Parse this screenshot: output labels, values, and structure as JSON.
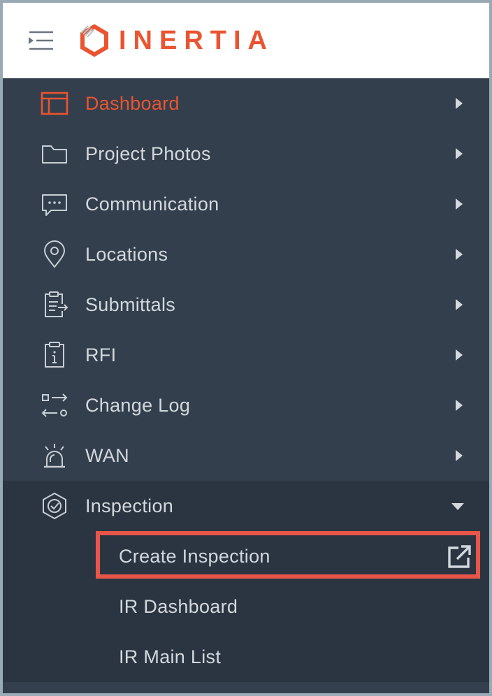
{
  "brand": {
    "name": "INERTIA",
    "color": "#ea5430"
  },
  "header": {
    "menu_icon": "menu-collapse-icon"
  },
  "nav": {
    "items": [
      {
        "label": "Dashboard",
        "icon": "dashboard-icon",
        "active": true
      },
      {
        "label": "Project Photos",
        "icon": "folder-icon"
      },
      {
        "label": "Communication",
        "icon": "chat-icon"
      },
      {
        "label": "Locations",
        "icon": "location-pin-icon"
      },
      {
        "label": "Submittals",
        "icon": "clipboard-arrow-icon"
      },
      {
        "label": "RFI",
        "icon": "clipboard-info-icon"
      },
      {
        "label": "Change Log",
        "icon": "swap-arrows-icon"
      },
      {
        "label": "WAN",
        "icon": "alarm-light-icon"
      }
    ],
    "inspection": {
      "label": "Inspection",
      "icon": "shield-check-icon",
      "expanded": true,
      "children": [
        {
          "label": "Create Inspection",
          "icon": "external-link-icon",
          "highlighted": true
        },
        {
          "label": "IR Dashboard"
        },
        {
          "label": "IR Main List"
        }
      ]
    }
  },
  "colors": {
    "sidebar": "#333f4c",
    "sidebar_open": "#2b3541",
    "text": "#d3d8de",
    "accent": "#ea5430",
    "highlight": "#e8564a"
  }
}
